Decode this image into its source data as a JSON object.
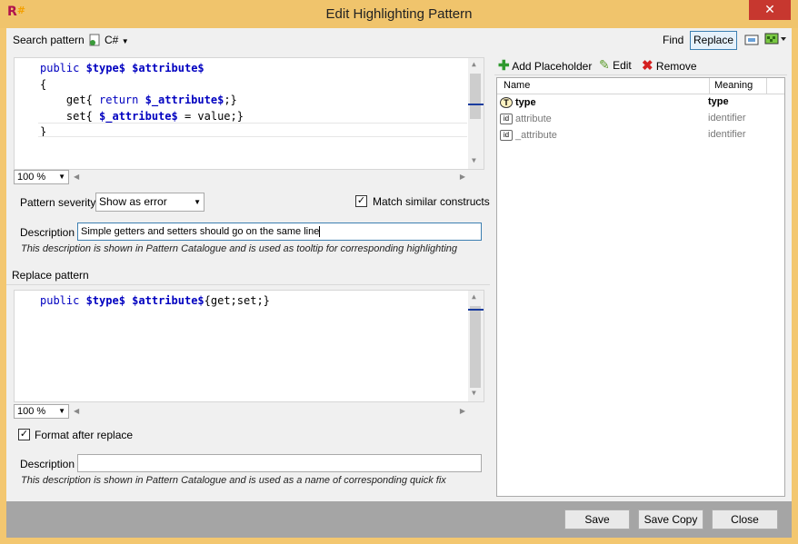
{
  "window": {
    "title": "Edit Highlighting Pattern",
    "app_icon": "resharper-icon",
    "close_symbol": "✕"
  },
  "toolbar": {
    "search_pattern_label": "Search pattern",
    "language": "C#",
    "find_label": "Find",
    "replace_label": "Replace"
  },
  "search_editor": {
    "lines": [
      [
        {
          "t": "kw",
          "v": "public "
        },
        {
          "t": "ph",
          "v": "$type$"
        },
        {
          "t": "",
          "v": " "
        },
        {
          "t": "ph",
          "v": "$attribute$"
        }
      ],
      [
        {
          "t": "",
          "v": "{"
        }
      ],
      [
        {
          "t": "",
          "v": "    get{ "
        },
        {
          "t": "kw",
          "v": "return "
        },
        {
          "t": "ph",
          "v": "$_attribute$"
        },
        {
          "t": "",
          "v": ";}"
        }
      ],
      [
        {
          "t": "",
          "v": "    set{ "
        },
        {
          "t": "ph",
          "v": "$_attribute$"
        },
        {
          "t": "",
          "v": " = value;}"
        }
      ],
      [
        {
          "t": "",
          "v": "}"
        }
      ]
    ],
    "zoom": "100 %"
  },
  "severity": {
    "label": "Pattern severity",
    "value": "Show as error"
  },
  "match_similar": {
    "label": "Match similar constructs",
    "checked": true
  },
  "search_description": {
    "label": "Description",
    "value": "Simple getters and setters should go on the same line",
    "hint": "This description is shown in Pattern Catalogue and is used as tooltip for corresponding highlighting"
  },
  "replace_section": {
    "title": "Replace pattern"
  },
  "replace_editor": {
    "lines": [
      [
        {
          "t": "kw",
          "v": "public "
        },
        {
          "t": "ph",
          "v": "$type$"
        },
        {
          "t": "",
          "v": " "
        },
        {
          "t": "ph",
          "v": "$attribute$"
        },
        {
          "t": "",
          "v": "{get;set;}"
        }
      ]
    ],
    "zoom": "100 %"
  },
  "format_after_replace": {
    "label": "Format after replace",
    "checked": true
  },
  "replace_description": {
    "label": "Description",
    "value": "",
    "hint": "This description is shown in Pattern Catalogue and is used as a name of corresponding quick fix"
  },
  "placeholders_toolbar": {
    "add_label": "Add Placeholder",
    "edit_label": "Edit",
    "remove_label": "Remove"
  },
  "placeholders": {
    "columns": [
      "Name",
      "Meaning"
    ],
    "rows": [
      {
        "icon": "type-placeholder-icon",
        "name": "type",
        "meaning": "type",
        "bold": true
      },
      {
        "icon": "identifier-placeholder-icon",
        "name": "attribute",
        "meaning": "identifier",
        "bold": false
      },
      {
        "icon": "identifier-placeholder-icon",
        "name": "_attribute",
        "meaning": "identifier",
        "bold": false
      }
    ]
  },
  "footer": {
    "save_label": "Save",
    "save_copy_label": "Save Copy",
    "close_label": "Close"
  }
}
